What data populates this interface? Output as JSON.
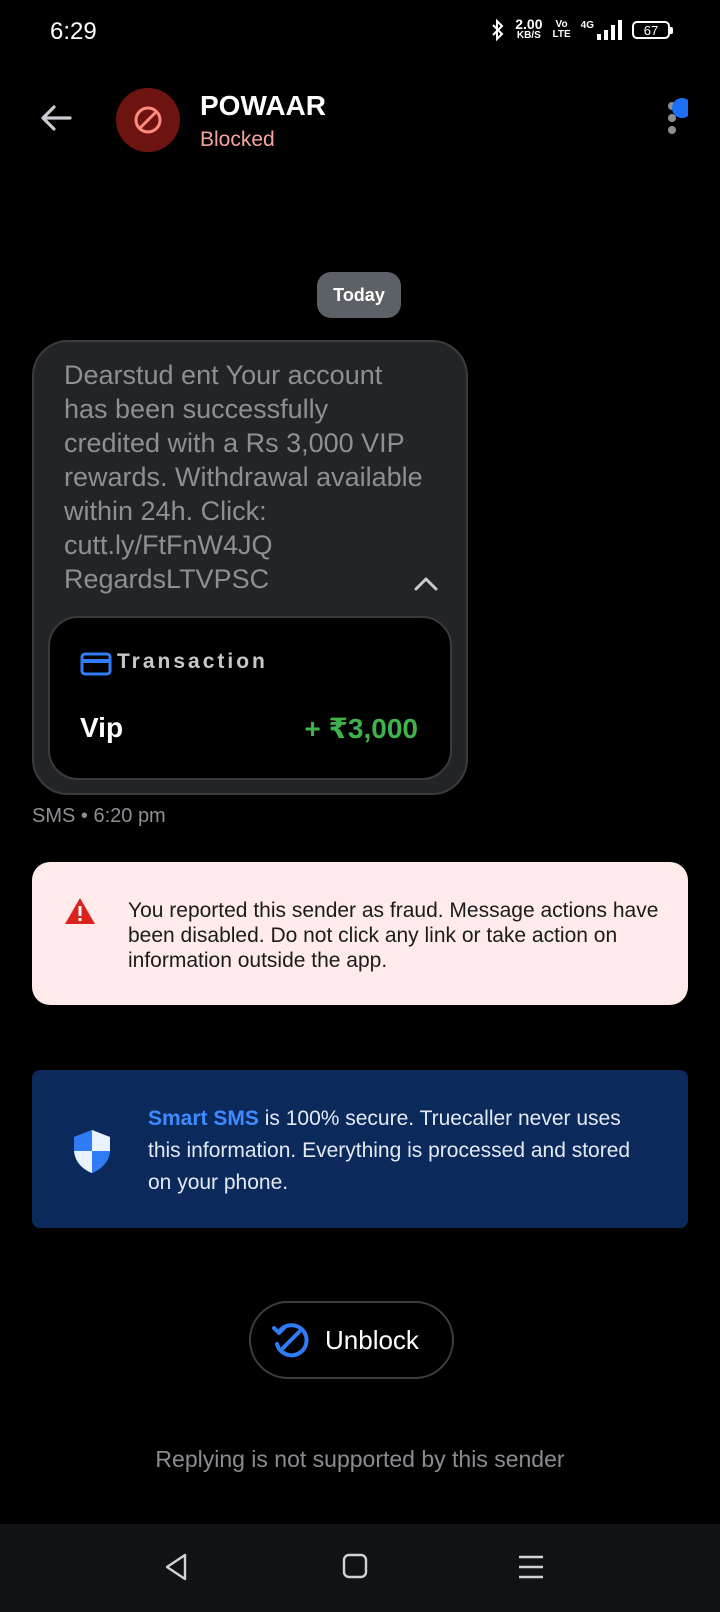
{
  "status_bar": {
    "time": "6:29",
    "net_speed": "2.00",
    "net_unit": "KB/S",
    "volte_top": "Vo",
    "volte_bottom": "LTE",
    "network": "4G",
    "battery": "67"
  },
  "header": {
    "contact_name": "POWAAR",
    "contact_status": "Blocked"
  },
  "conversation": {
    "date_chip": "Today",
    "message": {
      "text": "Dearstud ent Your account has been successfully credited with a Rs 3,000 VIP rewards. Withdrawal available within 24h. Click: cutt.ly/FtFnW4JQ RegardsLTVPSC",
      "transaction_label": "Transaction",
      "transaction_name": "Vip",
      "transaction_amount": "+ ₹3,000",
      "meta": "SMS • 6:20 pm"
    }
  },
  "fraud_notice": {
    "text": "You reported this sender as fraud. Message actions have been disabled. Do not click any link or take action on information outside the app."
  },
  "secure_notice": {
    "brand": "Smart SMS",
    "text": " is 100% secure. Truecaller never uses this information. Everything is processed and stored on your phone."
  },
  "actions": {
    "unblock_label": "Unblock",
    "reply_note": "Replying is not supported by this sender"
  },
  "colors": {
    "accent_blue": "#2f7cf6",
    "blocked_red": "#6e1410",
    "amount_green": "#3fb24c",
    "fraud_bg": "#ffebe9",
    "secure_bg": "#0b2a5b"
  }
}
